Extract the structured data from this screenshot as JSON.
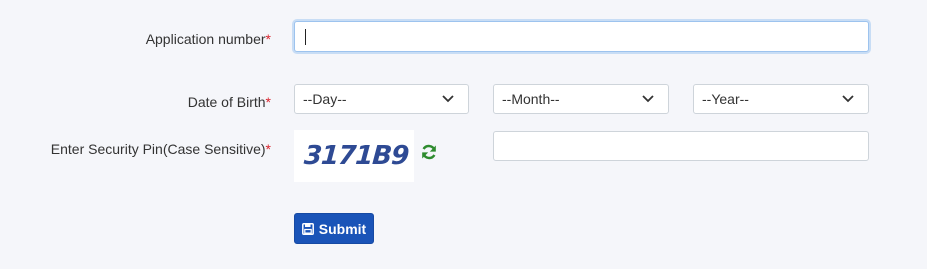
{
  "form": {
    "application_number": {
      "label": "Application number",
      "required_mark": "*",
      "value": ""
    },
    "dob": {
      "label": "Date of Birth",
      "required_mark": "*",
      "day": "--Day--",
      "month": "--Month--",
      "year": "--Year--"
    },
    "security_pin": {
      "label": "Enter Security Pin(Case Sensitive)",
      "required_mark": "*",
      "captcha_text": "3171B9",
      "value": ""
    },
    "submit_label": "Submit"
  },
  "icons": {
    "dropdown": "chevron-down-icon",
    "refresh": "refresh-icon",
    "submit": "save-icon"
  },
  "colors": {
    "required": "#d9232d",
    "submit_bg": "#1a54b8",
    "refresh": "#2e8b2e",
    "captcha_text": "#2e4a94",
    "focus_border": "#9dc3ee"
  }
}
